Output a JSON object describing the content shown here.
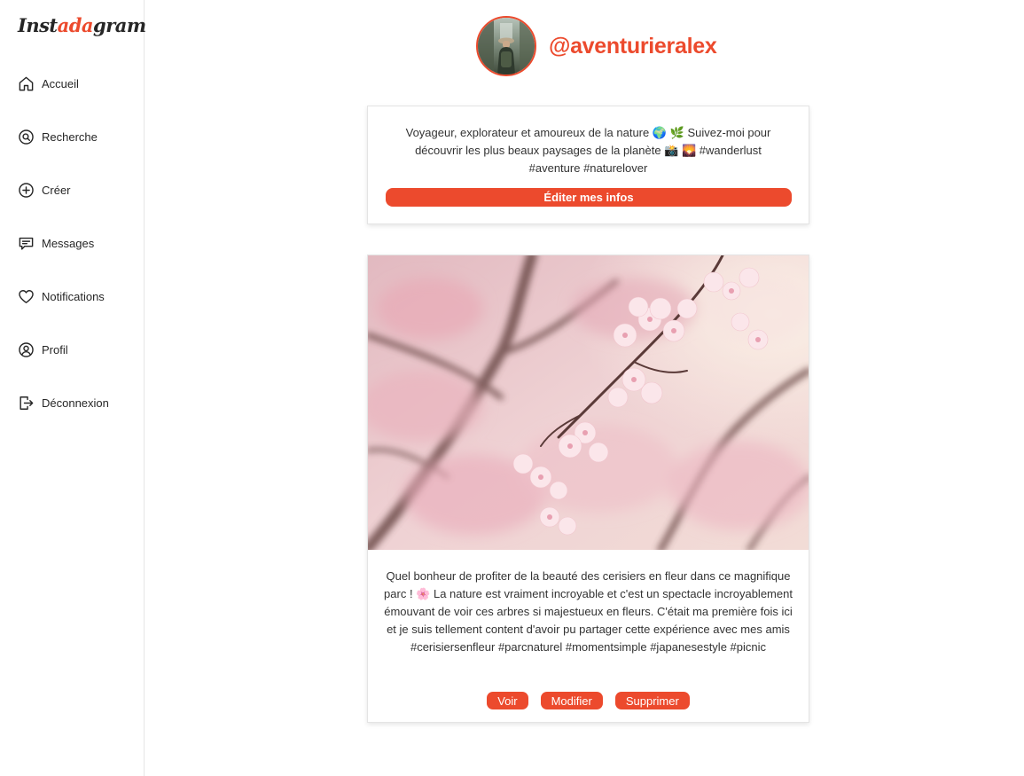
{
  "app": {
    "logo_prefix": "Inst",
    "logo_accent": "ada",
    "logo_suffix": "gram",
    "accent_color": "#ec4a2d"
  },
  "sidebar": {
    "items": [
      {
        "label": "Accueil",
        "icon": "home-icon"
      },
      {
        "label": "Recherche",
        "icon": "search-icon"
      },
      {
        "label": "Créer",
        "icon": "plus-circle-icon"
      },
      {
        "label": "Messages",
        "icon": "message-icon"
      },
      {
        "label": "Notifications",
        "icon": "heart-icon"
      },
      {
        "label": "Profil",
        "icon": "user-circle-icon"
      },
      {
        "label": "Déconnexion",
        "icon": "logout-icon"
      }
    ]
  },
  "profile": {
    "username": "@aventurieralex",
    "avatar": "avatar-photo"
  },
  "bio": {
    "text": "Voyageur, explorateur et amoureux de la nature 🌍 🌿 Suivez-moi pour découvrir les plus beaux paysages de la planète 📸 🌄 #wanderlust #aventure #naturelover",
    "edit_label": "Éditer mes infos"
  },
  "post": {
    "image": "cherry-blossom-photo",
    "caption": "Quel bonheur de profiter de la beauté des cerisiers en fleur dans ce magnifique parc ! 🌸 La nature est vraiment incroyable et c'est un spectacle incroyablement émouvant de voir ces arbres si majestueux en fleurs. C'était ma première fois ici et je suis tellement content d'avoir pu partager cette expérience avec mes amis #cerisiersenfleur #parcnaturel #momentsimple #japanesestyle #picnic",
    "view_label": "Voir",
    "edit_label": "Modifier",
    "delete_label": "Supprimer"
  }
}
